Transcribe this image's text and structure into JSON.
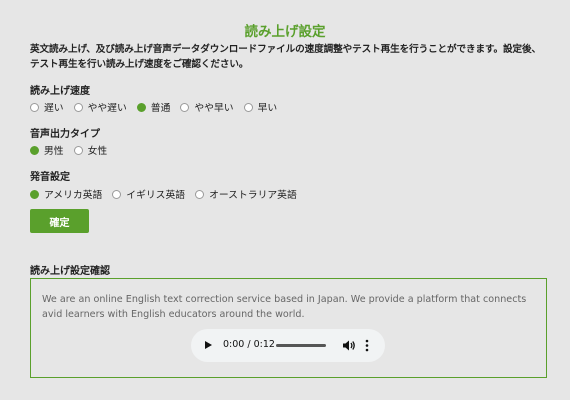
{
  "page_title": "読み上げ設定",
  "description": "英文読み上げ、及び読み上げ音声データダウンロードファイルの速度調整やテスト再生を行うことができます。設定後、テスト再生を行い読み上げ速度をご確認ください。",
  "speed": {
    "label": "読み上げ速度",
    "options": [
      "遅い",
      "やや遅い",
      "普通",
      "やや早い",
      "早い"
    ],
    "selected": "普通"
  },
  "voice_type": {
    "label": "音声出力タイプ",
    "options": [
      "男性",
      "女性"
    ],
    "selected": "男性"
  },
  "pronunciation": {
    "label": "発音設定",
    "options": [
      "アメリカ英語",
      "イギリス英語",
      "オーストラリア英語"
    ],
    "selected": "アメリカ英語"
  },
  "confirm_button": "確定",
  "confirm_section": {
    "heading": "読み上げ設定確認",
    "sample_text": "We are an online English text correction service based in Japan. We provide a platform that connects avid learners with English educators around the world.",
    "player": {
      "time": "0:00 / 0:12",
      "progress": 0
    }
  },
  "colors": {
    "accent": "#5aa02c",
    "background": "#e6e6e6"
  },
  "icons": [
    "play-icon",
    "volume-icon",
    "more-options-icon"
  ]
}
